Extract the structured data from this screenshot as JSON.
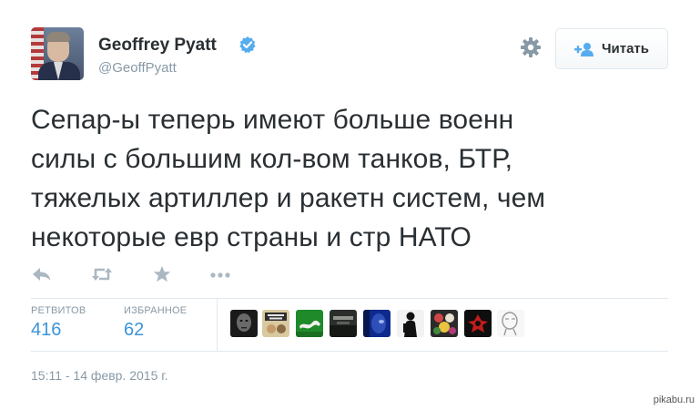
{
  "header": {
    "name": "Geoffrey Pyatt",
    "handle": "@GeoffPyatt",
    "follow_label": "Читать",
    "icons": [
      "avatar",
      "verified-badge-icon",
      "gear-icon",
      "add-user-icon"
    ],
    "accent": "#55acee"
  },
  "tweet": {
    "lines": [
      "Сепар-ы теперь имеют больше военн",
      "силы с большим кол-вом танков, БТР,",
      "тяжелых артиллер и ракетн систем, чем",
      "некоторые евр страны и стр НАТО"
    ]
  },
  "actions": [
    "reply-icon",
    "retweet-icon",
    "favorite-icon",
    "more-icon"
  ],
  "stats": {
    "retweets_label": "РЕТВИТОВ",
    "retweets_count": "416",
    "favorites_label": "ИЗБРАННОЕ",
    "favorites_count": "62",
    "link_color": "#3b94d9"
  },
  "favoriters": {
    "avatars": [
      {
        "name": "dark-face",
        "bg": "#1a1a1a",
        "fg": "#7a7a7a"
      },
      {
        "name": "drum-and-bass",
        "bg": "#d9c9a0",
        "fg": "#3a3a3a"
      },
      {
        "name": "green-lizard",
        "bg": "#1f8a2a",
        "fg": "#f0f0f0"
      },
      {
        "name": "dark-landscape",
        "bg": "#2b2e2b",
        "fg": "#8f948c"
      },
      {
        "name": "blue-face",
        "bg": "#0d2a8c",
        "fg": "#5c7bd6"
      },
      {
        "name": "silhouette",
        "bg": "#f2f2f2",
        "fg": "#111111"
      },
      {
        "name": "flowers",
        "bg": "#2a2a2a",
        "fg": "#d24545"
      },
      {
        "name": "red-emblem",
        "bg": "#0e0e0e",
        "fg": "#c21c1c"
      },
      {
        "name": "sketch-head",
        "bg": "#f7f7f7",
        "fg": "#9a9a9a"
      }
    ]
  },
  "footer": {
    "timestamp": "15:11 - 14 февр. 2015 г.",
    "watermark": "pikabu.ru"
  }
}
